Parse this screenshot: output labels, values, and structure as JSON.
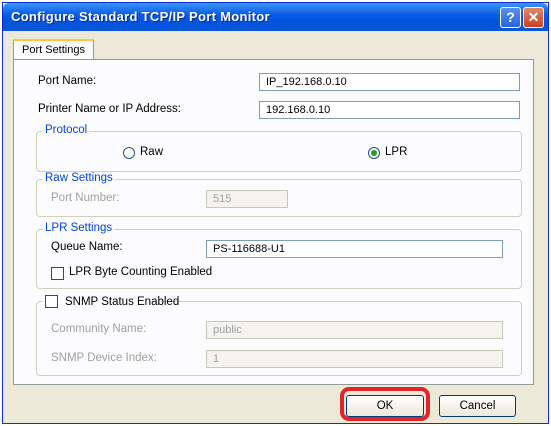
{
  "window": {
    "title": "Configure Standard TCP/IP Port Monitor",
    "help_glyph": "?",
    "close_glyph": "✕"
  },
  "tab": {
    "label": "Port Settings"
  },
  "port_name": {
    "label": "Port Name:",
    "value": "IP_192.168.0.10"
  },
  "printer_address": {
    "label": "Printer Name or IP Address:",
    "value": "192.168.0.10"
  },
  "protocol": {
    "legend": "Protocol",
    "raw_label": "Raw",
    "lpr_label": "LPR",
    "selected": "LPR"
  },
  "raw_settings": {
    "legend": "Raw Settings",
    "port_number_label": "Port Number:",
    "port_number_value": "515"
  },
  "lpr_settings": {
    "legend": "LPR Settings",
    "queue_name_label": "Queue Name:",
    "queue_name_value": "PS-116688-U1",
    "byte_counting_label": "LPR Byte Counting Enabled"
  },
  "snmp": {
    "status_label": "SNMP Status Enabled",
    "community_label": "Community Name:",
    "community_value": "public",
    "device_index_label": "SNMP Device Index:",
    "device_index_value": "1"
  },
  "buttons": {
    "ok": "OK",
    "cancel": "Cancel"
  },
  "colors": {
    "titlebar": "#0054e3",
    "legend_text": "#0046d5",
    "highlight": "#e4242a"
  }
}
